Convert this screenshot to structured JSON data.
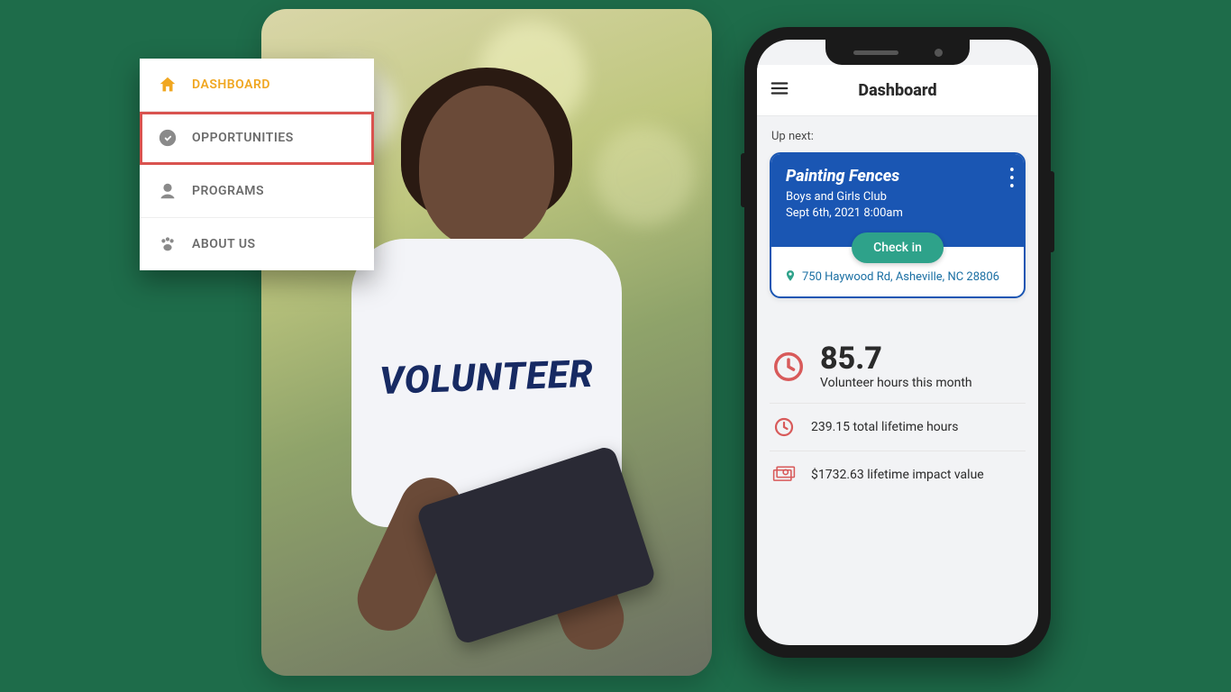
{
  "photo": {
    "shirt_text": "VOLUNTEER"
  },
  "sidebar": {
    "items": [
      {
        "label": "DASHBOARD"
      },
      {
        "label": "OPPORTUNITIES"
      },
      {
        "label": "PROGRAMS"
      },
      {
        "label": "ABOUT US"
      }
    ]
  },
  "app": {
    "title": "Dashboard",
    "up_next_label": "Up next:",
    "event": {
      "title": "Painting Fences",
      "org": "Boys and Girls Club",
      "datetime": "Sept 6th, 2021 8:00am",
      "checkin_label": "Check in",
      "address": "750 Haywood Rd, Asheville, NC 28806"
    },
    "stats": {
      "month_hours": "85.7",
      "month_hours_label": "Volunteer hours this month",
      "lifetime_hours": "239.15 total lifetime hours",
      "lifetime_value": "$1732.63 lifetime impact value"
    }
  },
  "colors": {
    "accent_gold": "#f0a722",
    "accent_red": "#d9534f",
    "brand_blue": "#1a56b3",
    "teal": "#2ea28a",
    "stat_red": "#d85a5a"
  }
}
